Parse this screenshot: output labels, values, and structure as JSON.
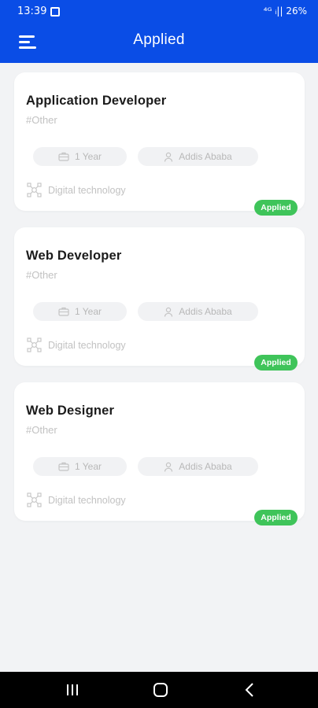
{
  "status_bar": {
    "time": "13:39",
    "indicators": "⁴ᴳ ᵢ|| 26%"
  },
  "app_bar": {
    "title": "Applied"
  },
  "jobs": [
    {
      "title": "Application Developer",
      "tag": "#Other",
      "experience": "1 Year",
      "location": "Addis Ababa",
      "category": "Digital technology",
      "status": "Applied"
    },
    {
      "title": "Web Developer",
      "tag": "#Other",
      "experience": "1 Year",
      "location": "Addis Ababa",
      "category": "Digital technology",
      "status": "Applied"
    },
    {
      "title": "Web Designer",
      "tag": "#Other",
      "experience": "1 Year",
      "location": "Addis Ababa",
      "category": "Digital technology",
      "status": "Applied"
    }
  ],
  "colors": {
    "primary": "#0a4de6",
    "applied_badge": "#3fc45a",
    "background": "#f2f3f5"
  },
  "icons": {
    "menu": "hamburger-menu-icon",
    "experience": "briefcase-icon",
    "location": "person-location-icon",
    "category": "network-icon"
  }
}
